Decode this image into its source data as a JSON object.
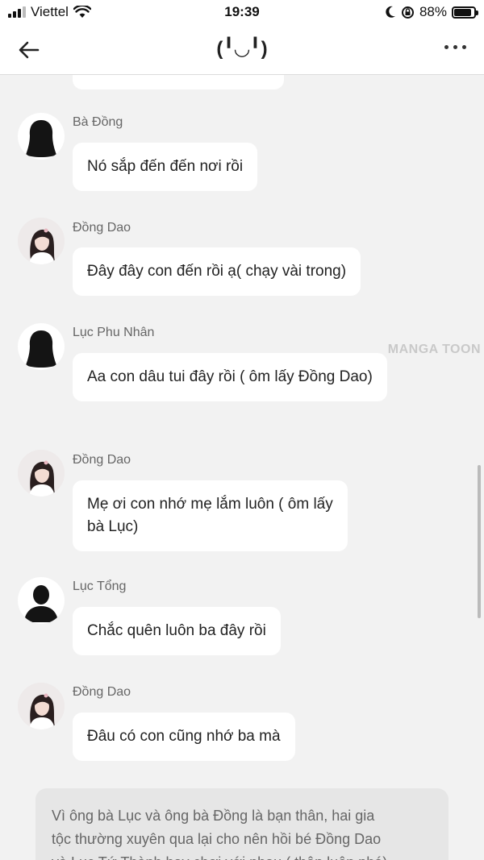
{
  "status_bar": {
    "carrier": "Viettel",
    "time": "19:39",
    "battery_percent": "88%",
    "battery_level": 0.88,
    "icons": [
      "signal-icon",
      "wifi-icon",
      "moon-icon",
      "rotation-lock-icon",
      "battery-icon"
    ]
  },
  "nav": {
    "title": "(╹◡╹)",
    "back_icon": "back-arrow-icon",
    "more_icon": "more-dots-icon"
  },
  "messages": [
    {
      "sender": "Bà Đồng",
      "text": "Nó sắp đến đến nơi rồi",
      "avatar": "silhouette-woman"
    },
    {
      "sender": "Đồng Dao",
      "text": "Đây đây con đến rồi ạ( chạy vài trong)",
      "avatar": "girl-photo"
    },
    {
      "sender": "Lục Phu Nhân",
      "text": "Aa con dâu tui đây rồi ( ôm lấy Đồng Dao)",
      "avatar": "silhouette-woman"
    },
    {
      "sender": "Đồng Dao",
      "text_lines": [
        "Mẹ ơi con nhớ mẹ lắm luôn ( ôm lấy",
        "bà Lục)"
      ],
      "avatar": "girl-photo"
    },
    {
      "sender": "Lục Tổng",
      "text": "Chắc quên luôn ba đây rồi",
      "avatar": "silhouette-man"
    },
    {
      "sender": "Đồng Dao",
      "text": "Đâu có con cũng nhớ ba mà",
      "avatar": "girl-photo"
    }
  ],
  "narration_lines": [
    "Vì ông bà Lục và ông bà Đồng là bạn thân, hai gia",
    "tộc thường xuyên qua lại cho nên hồi bé Đồng Dao",
    "và Lục Tứ Thành hay chơi với nhau ( thân luôn phá)"
  ],
  "watermark": "MANGA TOON",
  "colors": {
    "background": "#f2f2f2",
    "bubble": "#ffffff",
    "narration_bg": "#e6e6e6",
    "sender_text": "#666666"
  }
}
